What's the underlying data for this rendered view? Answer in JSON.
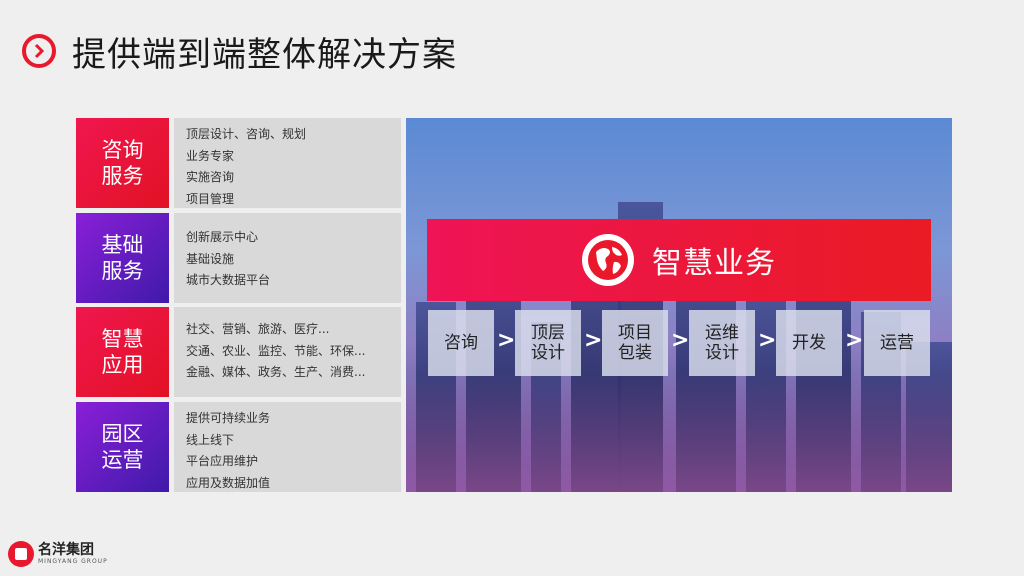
{
  "title": "提供端到端整体解决方案",
  "categories": [
    {
      "label": "咨询\n服务",
      "items": [
        "顶层设计、咨询、规划",
        "业务专家",
        "实施咨询",
        "项目管理"
      ]
    },
    {
      "label": "基础\n服务",
      "items": [
        "创新展示中心",
        "基础设施",
        "城市大数据平台"
      ]
    },
    {
      "label": "智慧\n应用",
      "items": [
        "社交、营销、旅游、医疗...",
        "交通、农业、监控、节能、环保...",
        "金融、媒体、政务、生产、消费..."
      ]
    },
    {
      "label": "园区\n运营",
      "items": [
        "提供可持续业务",
        "线上线下",
        "平台应用维护",
        "应用及数据加值"
      ]
    }
  ],
  "banner": {
    "title": "智慧业务"
  },
  "steps": [
    "咨询",
    "顶层\n设计",
    "项目\n包装",
    "运维\n设计",
    "开发",
    "运营"
  ],
  "arrow_glyph": ">",
  "logo": {
    "name_cn": "名洋集团",
    "name_en": "MINGYANG GROUP"
  },
  "colors": {
    "accent_red": "#e8192c",
    "purple": "#5b1bc2"
  }
}
